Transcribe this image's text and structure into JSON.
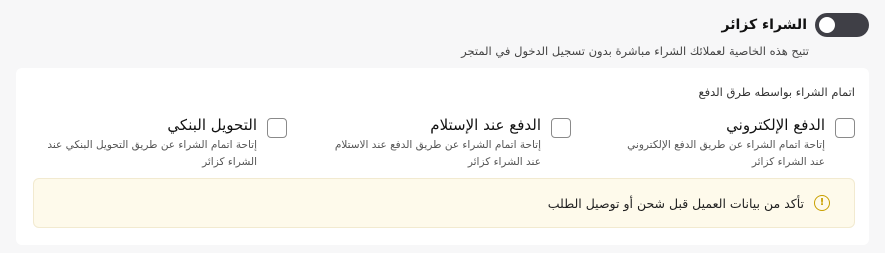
{
  "toggle": {
    "label": "الشراء كزائر",
    "enabled": true,
    "description": "تتيح هذه الخاصية لعملائك الشراء مباشرة بدون تسجيل الدخول في المتجر"
  },
  "payment_section": {
    "title": "اتمام الشراء بواسطه طرق الدفع",
    "options": [
      {
        "title": "الدفع الإلكتروني",
        "description": "إتاحة اتمام الشراء عن طريق الدفع الإلكتروني عند الشراء كزائر",
        "checked": false
      },
      {
        "title": "الدفع عند الإستلام",
        "description": "إتاحة اتمام الشراء عن طريق الدفع عند الاستلام عند الشراء كزائر",
        "checked": false
      },
      {
        "title": "التحويل البنكي",
        "description": "إتاحة اتمام الشراء عن طريق التحويل البنكي عند الشراء كزائر",
        "checked": false
      }
    ]
  },
  "notice": {
    "icon": "warning-circle-icon",
    "icon_glyph": "!",
    "text": "تأكد من بيانات العميل قبل شحن أو توصيل الطلب",
    "accent": "#c9a000"
  }
}
